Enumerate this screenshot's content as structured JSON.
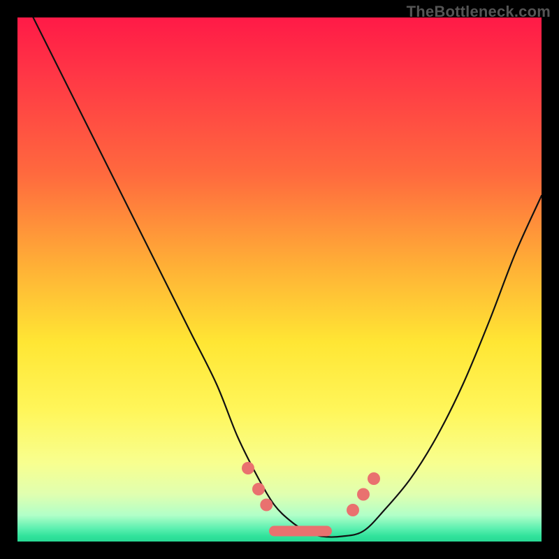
{
  "attribution": "TheBottleneck.com",
  "colors": {
    "background": "#000000",
    "gradient_top": "#ff1a47",
    "gradient_bottom": "#29d995",
    "curve": "#111111",
    "marker": "#e9716f"
  },
  "chart_data": {
    "type": "line",
    "title": "",
    "xlabel": "",
    "ylabel": "",
    "xlim": [
      0,
      100
    ],
    "ylim": [
      0,
      100
    ],
    "grid": false,
    "legend": false,
    "series": [
      {
        "name": "bottleneck-curve",
        "x": [
          3,
          8,
          13,
          18,
          23,
          28,
          33,
          38,
          42,
          46,
          49,
          52,
          55,
          58,
          62,
          66,
          70,
          75,
          80,
          85,
          90,
          95,
          100
        ],
        "y": [
          100,
          90,
          80,
          70,
          60,
          50,
          40,
          30,
          20,
          12,
          7,
          4,
          2,
          1,
          1,
          2,
          6,
          12,
          20,
          30,
          42,
          55,
          66
        ]
      }
    ],
    "markers": {
      "left_pair": [
        {
          "x": 44,
          "y": 14
        },
        {
          "x": 46,
          "y": 10
        },
        {
          "x": 47.5,
          "y": 7
        }
      ],
      "right_pair": [
        {
          "x": 64,
          "y": 6
        },
        {
          "x": 66,
          "y": 9
        },
        {
          "x": 68,
          "y": 12
        }
      ],
      "flat_bar": {
        "x0": 48,
        "x1": 60,
        "y": 2,
        "h": 2
      }
    }
  }
}
